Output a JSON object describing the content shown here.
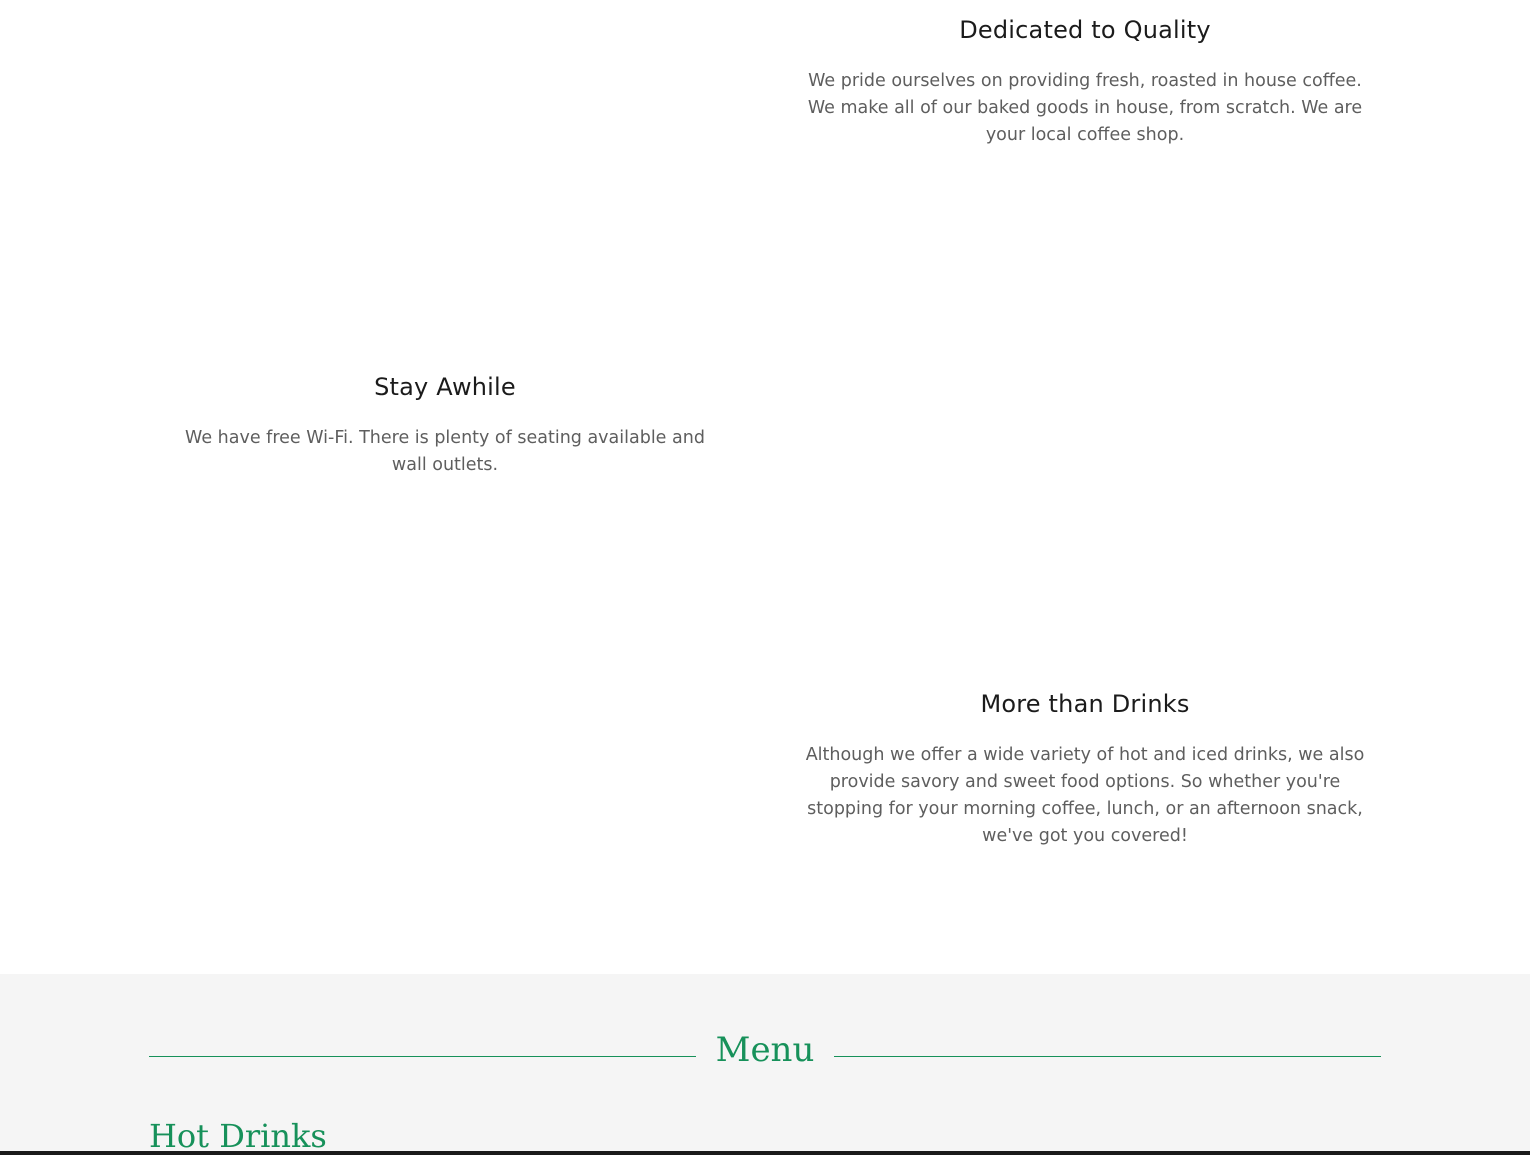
{
  "features": [
    {
      "title": "Dedicated to Quality",
      "text": "We pride ourselves on providing fresh, roasted in house coffee. We make all of our baked goods in house, from scratch.  We are your local coffee shop."
    },
    {
      "title": "Stay Awhile",
      "text": "We have free Wi-Fi.  There is plenty of seating available and wall outlets."
    },
    {
      "title": "More than Drinks",
      "text": "Although we offer a wide variety of hot and iced drinks, we also provide savory and sweet food options. So whether you're stopping for your morning coffee, lunch, or an afternoon snack, we've got you covered!"
    }
  ],
  "menu": {
    "title": "Menu",
    "categories": [
      {
        "title": "Hot Drinks"
      }
    ]
  },
  "colors": {
    "accent": "#17915a",
    "heading": "#1b1b1b",
    "body_text": "#5e5e5e",
    "menu_background": "#f5f5f5"
  }
}
